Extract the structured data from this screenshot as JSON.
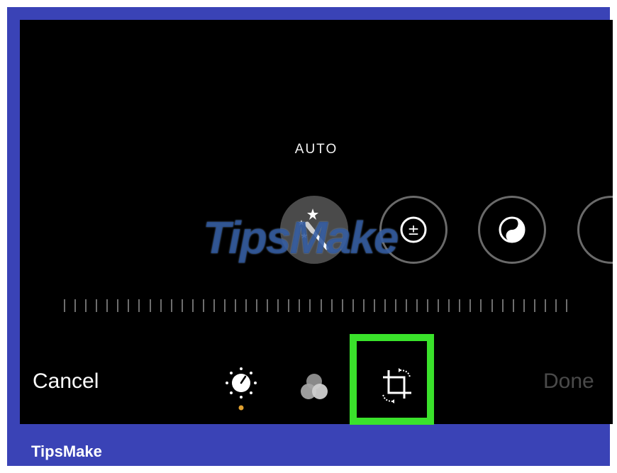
{
  "screen": {
    "mode_label": "AUTO"
  },
  "adjustments": [
    {
      "name": "auto",
      "icon": "magic-wand-icon",
      "selected": true
    },
    {
      "name": "light",
      "icon": "plus-minus-icon",
      "selected": false
    },
    {
      "name": "black-and-white",
      "icon": "yin-yang-icon",
      "selected": false
    },
    {
      "name": "more",
      "icon": "partial-circle-icon",
      "selected": false
    }
  ],
  "watermark": "TipsMake",
  "toolbar": {
    "cancel_label": "Cancel",
    "done_label": "Done",
    "tools": [
      {
        "name": "adjust",
        "icon": "dial-icon",
        "indicator_color": "#e0a030"
      },
      {
        "name": "filters",
        "icon": "filters-icon"
      },
      {
        "name": "crop",
        "icon": "crop-rotate-icon",
        "highlighted": true
      }
    ]
  },
  "colors": {
    "frame": "#3a43b6",
    "highlight": "#3ae22b",
    "done_disabled": "#4a4a4a"
  },
  "footer": {
    "brand": "TipsMake"
  }
}
